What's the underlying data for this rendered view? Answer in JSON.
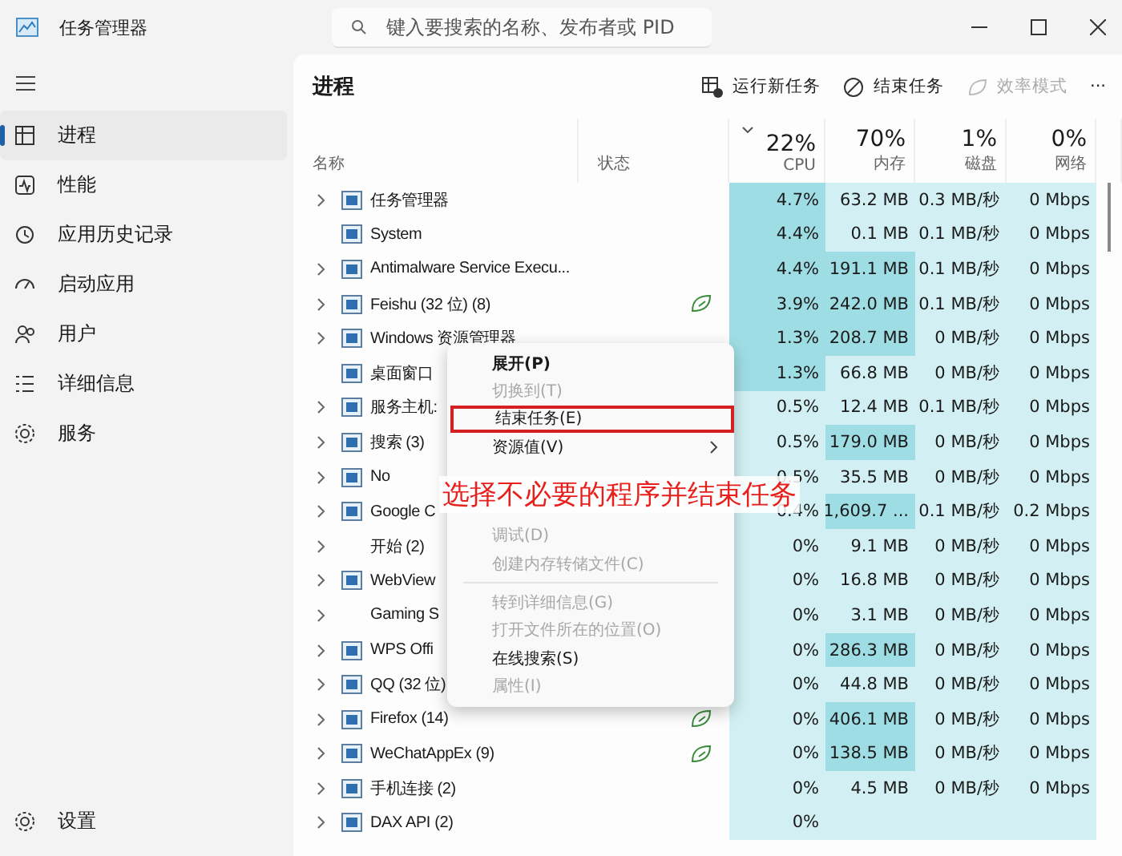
{
  "window": {
    "title": "任务管理器"
  },
  "search": {
    "placeholder": "键入要搜索的名称、发布者或 PID"
  },
  "sidebar": {
    "items": [
      {
        "label": "进程",
        "selected": true
      },
      {
        "label": "性能",
        "selected": false
      },
      {
        "label": "应用历史记录",
        "selected": false
      },
      {
        "label": "启动应用",
        "selected": false
      },
      {
        "label": "用户",
        "selected": false
      },
      {
        "label": "详细信息",
        "selected": false
      },
      {
        "label": "服务",
        "selected": false
      }
    ],
    "settings": "设置"
  },
  "page_title": "进程",
  "toolbar": [
    {
      "label": "运行新任务",
      "kind": "run",
      "disabled": false
    },
    {
      "label": "结束任务",
      "kind": "end",
      "disabled": false
    },
    {
      "label": "效率模式",
      "kind": "leaf",
      "disabled": true
    },
    {
      "label": "···",
      "kind": "more",
      "disabled": false
    }
  ],
  "columns": {
    "name": "名称",
    "status": "状态",
    "metrics": [
      {
        "percent": "22%",
        "label": "CPU",
        "sorted": true
      },
      {
        "percent": "70%",
        "label": "内存",
        "sorted": false
      },
      {
        "percent": "1%",
        "label": "磁盘",
        "sorted": false
      },
      {
        "percent": "0%",
        "label": "网络",
        "sorted": false
      }
    ]
  },
  "rows": [
    {
      "name": "任务管理器",
      "expandable": true,
      "has_icon": true,
      "efficiency": false,
      "cpu": "4.7%",
      "cpu_high": true,
      "memory": "63.2 MB",
      "memory_high": false,
      "disk": "0.3 MB/秒",
      "network": "0 Mbps"
    },
    {
      "name": "System",
      "expandable": false,
      "has_icon": true,
      "efficiency": false,
      "cpu": "4.4%",
      "cpu_high": true,
      "memory": "0.1 MB",
      "memory_high": false,
      "disk": "0.1 MB/秒",
      "network": "0 Mbps"
    },
    {
      "name": "Antimalware Service Execu...",
      "expandable": true,
      "has_icon": true,
      "efficiency": false,
      "cpu": "4.4%",
      "cpu_high": true,
      "memory": "191.1 MB",
      "memory_high": true,
      "disk": "0.1 MB/秒",
      "network": "0 Mbps"
    },
    {
      "name": "Feishu (32 位) (8)",
      "expandable": true,
      "has_icon": true,
      "efficiency": true,
      "cpu": "3.9%",
      "cpu_high": true,
      "memory": "242.0 MB",
      "memory_high": true,
      "disk": "0.1 MB/秒",
      "network": "0 Mbps"
    },
    {
      "name": "Windows 资源管理器",
      "expandable": true,
      "has_icon": true,
      "efficiency": false,
      "cpu": "1.3%",
      "cpu_high": true,
      "memory": "208.7 MB",
      "memory_high": true,
      "disk": "0 MB/秒",
      "network": "0 Mbps"
    },
    {
      "name": "桌面窗口",
      "expandable": false,
      "has_icon": true,
      "efficiency": false,
      "cpu": "1.3%",
      "cpu_high": true,
      "memory": "66.8 MB",
      "memory_high": false,
      "disk": "0 MB/秒",
      "network": "0 Mbps"
    },
    {
      "name": "服务主机:",
      "expandable": true,
      "has_icon": true,
      "efficiency": false,
      "cpu": "0.5%",
      "cpu_high": false,
      "memory": "12.4 MB",
      "memory_high": false,
      "disk": "0.1 MB/秒",
      "network": "0 Mbps"
    },
    {
      "name": "搜索 (3)",
      "expandable": true,
      "has_icon": true,
      "efficiency": false,
      "cpu": "0.5%",
      "cpu_high": false,
      "memory": "179.0 MB",
      "memory_high": true,
      "disk": "0 MB/秒",
      "network": "0 Mbps"
    },
    {
      "name": "No",
      "expandable": true,
      "has_icon": true,
      "efficiency": false,
      "cpu": "0.5%",
      "cpu_high": false,
      "memory": "35.5 MB",
      "memory_high": false,
      "disk": "0 MB/秒",
      "network": "0 Mbps"
    },
    {
      "name": "Google C",
      "expandable": true,
      "has_icon": true,
      "efficiency": false,
      "cpu": "0.4%",
      "cpu_high": false,
      "memory": "1,609.7 ...",
      "memory_high": true,
      "disk": "0.1 MB/秒",
      "network": "0.2 Mbps"
    },
    {
      "name": "开始 (2)",
      "expandable": true,
      "has_icon": false,
      "efficiency": false,
      "cpu": "0%",
      "cpu_high": false,
      "memory": "9.1 MB",
      "memory_high": false,
      "disk": "0 MB/秒",
      "network": "0 Mbps"
    },
    {
      "name": "WebView",
      "expandable": true,
      "has_icon": true,
      "efficiency": false,
      "cpu": "0%",
      "cpu_high": false,
      "memory": "16.8 MB",
      "memory_high": false,
      "disk": "0 MB/秒",
      "network": "0 Mbps"
    },
    {
      "name": "Gaming S",
      "expandable": true,
      "has_icon": false,
      "efficiency": false,
      "cpu": "0%",
      "cpu_high": false,
      "memory": "3.1 MB",
      "memory_high": false,
      "disk": "0 MB/秒",
      "network": "0 Mbps"
    },
    {
      "name": "WPS Offi",
      "expandable": true,
      "has_icon": true,
      "efficiency": false,
      "cpu": "0%",
      "cpu_high": false,
      "memory": "286.3 MB",
      "memory_high": true,
      "disk": "0 MB/秒",
      "network": "0 Mbps"
    },
    {
      "name": "QQ (32 位)",
      "expandable": true,
      "has_icon": true,
      "efficiency": false,
      "cpu": "0%",
      "cpu_high": false,
      "memory": "44.8 MB",
      "memory_high": false,
      "disk": "0 MB/秒",
      "network": "0 Mbps"
    },
    {
      "name": "Firefox (14)",
      "expandable": true,
      "has_icon": true,
      "efficiency": true,
      "cpu": "0%",
      "cpu_high": false,
      "memory": "406.1 MB",
      "memory_high": true,
      "disk": "0 MB/秒",
      "network": "0 Mbps"
    },
    {
      "name": "WeChatAppEx (9)",
      "expandable": true,
      "has_icon": true,
      "efficiency": true,
      "cpu": "0%",
      "cpu_high": false,
      "memory": "138.5 MB",
      "memory_high": true,
      "disk": "0 MB/秒",
      "network": "0 Mbps"
    },
    {
      "name": "手机连接 (2)",
      "expandable": true,
      "has_icon": true,
      "efficiency": false,
      "cpu": "0%",
      "cpu_high": false,
      "memory": "4.5 MB",
      "memory_high": false,
      "disk": "0 MB/秒",
      "network": "0 Mbps"
    },
    {
      "name": "DAX API (2)",
      "expandable": true,
      "has_icon": true,
      "efficiency": false,
      "cpu": "0%",
      "cpu_high": false,
      "memory_high": false
    }
  ],
  "context_menu": {
    "items": [
      {
        "kind": "item",
        "label": "展开(P)",
        "bold": true,
        "disabled": false,
        "submenu": false,
        "highlighted": false
      },
      {
        "kind": "item",
        "label": "切换到(T)",
        "bold": false,
        "disabled": true,
        "submenu": false,
        "highlighted": false
      },
      {
        "kind": "item",
        "label": "结束任务(E)",
        "bold": false,
        "disabled": false,
        "submenu": false,
        "highlighted": true
      },
      {
        "kind": "item",
        "label": "资源值(V)",
        "bold": false,
        "disabled": false,
        "submenu": true,
        "highlighted": false
      },
      {
        "kind": "covered"
      },
      {
        "kind": "item",
        "label": "调试(D)",
        "bold": false,
        "disabled": true,
        "submenu": false,
        "highlighted": false
      },
      {
        "kind": "item",
        "label": "创建内存转储文件(C)",
        "bold": false,
        "disabled": true,
        "submenu": false,
        "highlighted": false
      },
      {
        "kind": "separator"
      },
      {
        "kind": "item",
        "label": "转到详细信息(G)",
        "bold": false,
        "disabled": true,
        "submenu": false,
        "highlighted": false
      },
      {
        "kind": "item",
        "label": "打开文件所在的位置(O)",
        "bold": false,
        "disabled": true,
        "submenu": false,
        "highlighted": false
      },
      {
        "kind": "item",
        "label": "在线搜索(S)",
        "bold": false,
        "disabled": false,
        "submenu": false,
        "highlighted": false
      },
      {
        "kind": "item",
        "label": "属性(I)",
        "bold": false,
        "disabled": true,
        "submenu": false,
        "highlighted": false
      }
    ]
  },
  "annotation": "选择不必要的程序并结束任务"
}
